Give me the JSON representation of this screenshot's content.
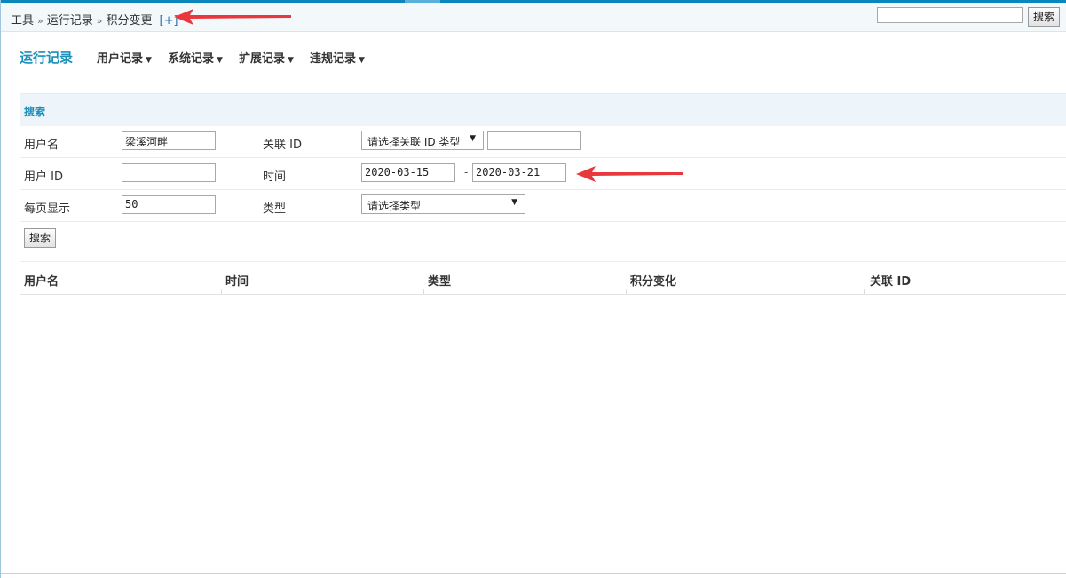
{
  "breadcrumb": {
    "items": [
      "工具",
      "运行记录",
      "积分变更"
    ],
    "separator": "»",
    "add_label": "[+]"
  },
  "header_search": {
    "value": "",
    "button_label": "搜索"
  },
  "nav": {
    "title": "运行记录",
    "items": [
      {
        "label": "用户记录",
        "caret": "▼"
      },
      {
        "label": "系统记录",
        "caret": "▼"
      },
      {
        "label": "扩展记录",
        "caret": "▼"
      },
      {
        "label": "违规记录",
        "caret": "▼"
      }
    ]
  },
  "search_form": {
    "title": "搜索",
    "username_label": "用户名",
    "username_value": "梁溪河畔",
    "related_id_label": "关联 ID",
    "related_id_type": "请选择关联 ID 类型",
    "related_id_value": "",
    "user_id_label": "用户 ID",
    "user_id_value": "",
    "time_label": "时间",
    "date_from": "2020-03-15",
    "date_separator": "-",
    "date_to": "2020-03-21",
    "per_page_label": "每页显示",
    "per_page_value": "50",
    "type_label": "类型",
    "type_value": "请选择类型",
    "submit_label": "搜索"
  },
  "table": {
    "columns": [
      "用户名",
      "时间",
      "类型",
      "积分变化",
      "关联 ID"
    ]
  },
  "colors": {
    "accent": "#1d8fbc",
    "top_bar": "#0a86bd",
    "annotation_arrow": "#e8383d"
  },
  "icons": {
    "dropdown": "chevron-down-icon",
    "annotation": "red-arrow-icon"
  }
}
